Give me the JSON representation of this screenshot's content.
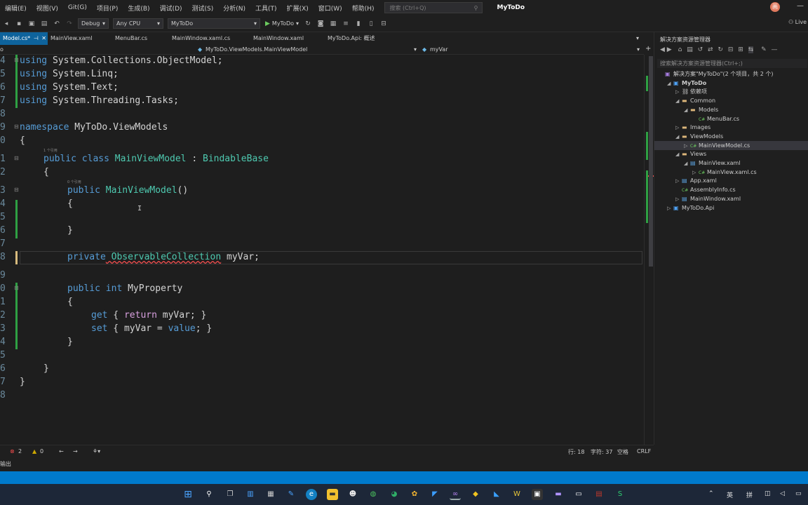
{
  "menu": {
    "items": [
      "编辑(E)",
      "视图(V)",
      "Git(G)",
      "项目(P)",
      "生成(B)",
      "调试(D)",
      "测试(S)",
      "分析(N)",
      "工具(T)",
      "扩展(X)",
      "窗口(W)",
      "帮助(H)"
    ],
    "search_placeholder": "搜索 (Ctrl+Q)",
    "app_title": "MyToDo"
  },
  "toolbar": {
    "config": "Debug",
    "platform": "Any CPU",
    "project": "MyToDo",
    "run_label": "MyToDo",
    "live_share": "Live"
  },
  "tabs": [
    {
      "label": "Model.cs*",
      "active": true
    },
    {
      "label": "MainView.xaml",
      "active": false
    },
    {
      "label": "MenuBar.cs",
      "active": false
    },
    {
      "label": "MainWindow.xaml.cs",
      "active": false
    },
    {
      "label": "MainWindow.xaml",
      "active": false
    },
    {
      "label": "MyToDo.Api: 概述",
      "active": false
    }
  ],
  "navbar": {
    "left": "o",
    "middle": "MyToDo.ViewModels.MainViewModel",
    "right": "myVar"
  },
  "code": {
    "line_numbers": [
      "4",
      "5",
      "6",
      "7",
      "8",
      "9",
      "0",
      "1",
      "2",
      "3",
      "4",
      "5",
      "6",
      "7",
      "8",
      "9",
      "0",
      "1",
      "2",
      "3",
      "4",
      "5",
      "6",
      "7",
      "8"
    ],
    "codelens_1": "1 个引用",
    "codelens_2": "0 个引用",
    "l4": [
      "using",
      " System.Collections.ObjectModel;"
    ],
    "l5": [
      "using",
      " System.Linq;"
    ],
    "l6": [
      "using",
      " System.Text;"
    ],
    "l7": [
      "using",
      " System.Threading.Tasks;"
    ],
    "l9_kw": "namespace",
    "l9_name": " MyToDo.ViewModels",
    "brace_open": "{",
    "brace_close": "}",
    "class_public": "public",
    "class_kw": " class ",
    "class_name": "MainViewModel",
    "class_colon": " : ",
    "class_base": "BindableBase",
    "ctor_public": "public",
    "ctor_name": " MainViewModel",
    "ctor_parens": "()",
    "field_private": "private",
    "field_type": " ObservableCollection",
    "field_name": " myVar;",
    "prop_public": "public",
    "prop_int": " int",
    "prop_name": " MyProperty",
    "get_kw": "get",
    "get_body_1": " { ",
    "get_return": "return",
    "get_body_2": " myVar; }",
    "set_kw": "set",
    "set_body_1": " { myVar = ",
    "set_value": "value",
    "set_body_2": "; }"
  },
  "editor_status": {
    "errors": "2",
    "warnings": "0",
    "line": "行: 18",
    "col": "字符: 37",
    "tabs": "空格",
    "eol": "CRLF"
  },
  "output_label": "输出",
  "solution": {
    "title": "解决方案资源管理器",
    "search_placeholder": "搜索解决方案资源管理器(Ctrl+;)",
    "items": [
      {
        "label": "解决方案\"MyToDo\"(2 个项目，共 2 个)",
        "indent": 0,
        "exp": "",
        "icon": "sln"
      },
      {
        "label": "MyToDo",
        "indent": 1,
        "exp": "◢",
        "icon": "proj"
      },
      {
        "label": "依赖项",
        "indent": 2,
        "exp": "▷",
        "icon": "dep"
      },
      {
        "label": "Common",
        "indent": 2,
        "exp": "◢",
        "icon": "folder"
      },
      {
        "label": "Models",
        "indent": 3,
        "exp": "◢",
        "icon": "folder"
      },
      {
        "label": "MenuBar.cs",
        "indent": 4,
        "exp": "",
        "icon": "cs"
      },
      {
        "label": "Images",
        "indent": 2,
        "exp": "▷",
        "icon": "folder"
      },
      {
        "label": "ViewModels",
        "indent": 2,
        "exp": "◢",
        "icon": "folder"
      },
      {
        "label": "MainViewModel.cs",
        "indent": 3,
        "exp": "▷",
        "icon": "cs",
        "selected": true
      },
      {
        "label": "Views",
        "indent": 2,
        "exp": "◢",
        "icon": "folder"
      },
      {
        "label": "MainView.xaml",
        "indent": 3,
        "exp": "◢",
        "icon": "xaml"
      },
      {
        "label": "MainView.xaml.cs",
        "indent": 4,
        "exp": "▷",
        "icon": "cs"
      },
      {
        "label": "App.xaml",
        "indent": 2,
        "exp": "▷",
        "icon": "xaml"
      },
      {
        "label": "AssemblyInfo.cs",
        "indent": 2,
        "exp": "",
        "icon": "cs"
      },
      {
        "label": "MainWindow.xaml",
        "indent": 2,
        "exp": "▷",
        "icon": "xaml"
      },
      {
        "label": "MyToDo.Api",
        "indent": 1,
        "exp": "▷",
        "icon": "proj"
      }
    ]
  },
  "tray": {
    "lang": "英",
    "ime": "拼"
  },
  "colors": {
    "accent": "#007acc",
    "tab_active": "#0e639c",
    "keyword": "#569cd6",
    "type": "#4ec9b0",
    "method": "#dcdcaa",
    "control": "#d8a0df"
  }
}
